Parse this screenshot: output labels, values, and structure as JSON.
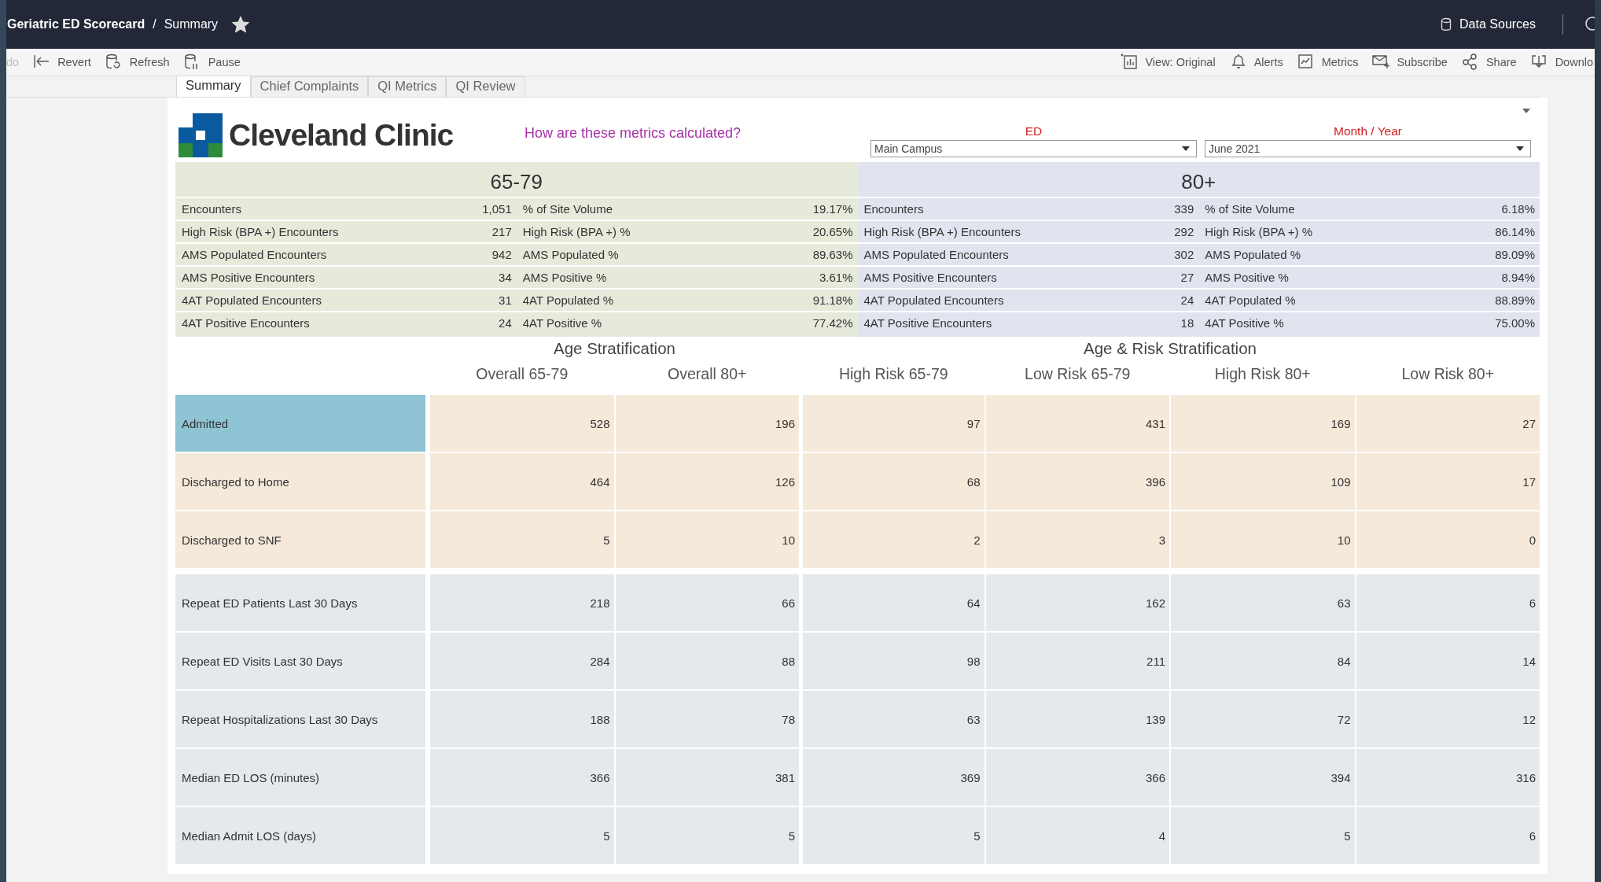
{
  "topbar": {
    "workbook": "Geriatric ED Scorecard",
    "separator": "/",
    "view": "Summary",
    "favorite": true,
    "data_sources": "Data Sources"
  },
  "toolbar": {
    "left": [
      {
        "label": "do",
        "kind": "undo",
        "disabled": true
      },
      {
        "label": "Revert",
        "kind": "revert",
        "disabled": false
      },
      {
        "label": "Refresh",
        "kind": "refresh",
        "disabled": false
      },
      {
        "label": "Pause",
        "kind": "pause",
        "disabled": false
      }
    ],
    "right": [
      {
        "label": "View: Original",
        "kind": "view",
        "disabled": false
      },
      {
        "label": "Alerts",
        "kind": "alerts",
        "disabled": false
      },
      {
        "label": "Metrics",
        "kind": "metrics",
        "disabled": false
      },
      {
        "label": "Subscribe",
        "kind": "subscribe",
        "disabled": false
      },
      {
        "label": "Share",
        "kind": "share",
        "disabled": false
      },
      {
        "label": "Downlo",
        "kind": "download",
        "disabled": false
      }
    ]
  },
  "tabs": [
    {
      "label": "Summary",
      "selected": true
    },
    {
      "label": "Chief Complaints",
      "selected": false
    },
    {
      "label": "QI Metrics",
      "selected": false
    },
    {
      "label": "QI Review",
      "selected": false
    }
  ],
  "header": {
    "logo": "Cleveland Clinic",
    "help_link": "How are these metrics calculated?",
    "filters": [
      {
        "label": "ED",
        "value": "Main Campus"
      },
      {
        "label": "Month / Year",
        "value": "June 2021"
      }
    ]
  },
  "summary": [
    {
      "title": "65-79",
      "color": "#e6eadb",
      "rows": [
        {
          "label": "Encounters",
          "value": "1,051",
          "pct_label": "% of Site Volume",
          "pct_value": "19.17%"
        },
        {
          "label": "High Risk (BPA +) Encounters",
          "value": "217",
          "pct_label": "High Risk (BPA +) %",
          "pct_value": "20.65%"
        },
        {
          "label": "AMS Populated Encounters",
          "value": "942",
          "pct_label": "AMS Populated %",
          "pct_value": "89.63%"
        },
        {
          "label": "AMS Positive Encounters",
          "value": "34",
          "pct_label": "AMS Positive %",
          "pct_value": "3.61%"
        },
        {
          "label": "4AT Populated Encounters",
          "value": "31",
          "pct_label": "4AT Populated %",
          "pct_value": "91.18%"
        },
        {
          "label": "4AT Positive Encounters",
          "value": "24",
          "pct_label": "4AT Positive %",
          "pct_value": "77.42%"
        }
      ]
    },
    {
      "title": "80+",
      "color": "#e1e4ef",
      "rows": [
        {
          "label": "Encounters",
          "value": "339",
          "pct_label": "% of Site Volume",
          "pct_value": "6.18%"
        },
        {
          "label": "High Risk (BPA +) Encounters",
          "value": "292",
          "pct_label": "High Risk (BPA +) %",
          "pct_value": "86.14%"
        },
        {
          "label": "AMS Populated Encounters",
          "value": "302",
          "pct_label": "AMS Populated %",
          "pct_value": "89.09%"
        },
        {
          "label": "AMS Positive Encounters",
          "value": "27",
          "pct_label": "AMS Positive %",
          "pct_value": "8.94%"
        },
        {
          "label": "4AT Populated Encounters",
          "value": "24",
          "pct_label": "4AT Populated %",
          "pct_value": "88.89%"
        },
        {
          "label": "4AT Positive Encounters",
          "value": "18",
          "pct_label": "4AT Positive %",
          "pct_value": "75.00%"
        }
      ]
    }
  ],
  "stratification": {
    "column_groups": [
      {
        "label": "Age Stratification",
        "columns": [
          "Overall 65-79",
          "Overall 80+"
        ]
      },
      {
        "label": "Age & Risk Stratification",
        "columns": [
          "High Risk 65-79",
          "Low Risk 65-79",
          "High Risk 80+",
          "Low Risk 80+"
        ]
      }
    ],
    "rows": [
      {
        "label": "Admitted",
        "kind": "disposition",
        "selected": true,
        "values": [
          "528",
          "196",
          "97",
          "431",
          "169",
          "27"
        ]
      },
      {
        "label": "Discharged to Home",
        "kind": "disposition",
        "selected": false,
        "values": [
          "464",
          "126",
          "68",
          "396",
          "109",
          "17"
        ]
      },
      {
        "label": "Discharged to SNF",
        "kind": "disposition",
        "selected": false,
        "values": [
          "5",
          "10",
          "2",
          "3",
          "10",
          "0"
        ]
      },
      {
        "label": "Repeat ED Patients Last 30 Days",
        "kind": "utilization",
        "selected": false,
        "values": [
          "218",
          "66",
          "64",
          "162",
          "63",
          "6"
        ]
      },
      {
        "label": "Repeat ED Visits Last 30 Days",
        "kind": "utilization",
        "selected": false,
        "values": [
          "284",
          "88",
          "98",
          "211",
          "84",
          "14"
        ]
      },
      {
        "label": "Repeat Hospitalizations Last 30 Days",
        "kind": "utilization",
        "selected": false,
        "values": [
          "188",
          "78",
          "63",
          "139",
          "72",
          "12"
        ]
      },
      {
        "label": "Median ED LOS (minutes)",
        "kind": "utilization",
        "selected": false,
        "values": [
          "366",
          "381",
          "369",
          "366",
          "394",
          "316"
        ]
      },
      {
        "label": "Median Admit LOS (days)",
        "kind": "utilization",
        "selected": false,
        "values": [
          "5",
          "5",
          "5",
          "4",
          "5",
          "6"
        ]
      }
    ]
  }
}
